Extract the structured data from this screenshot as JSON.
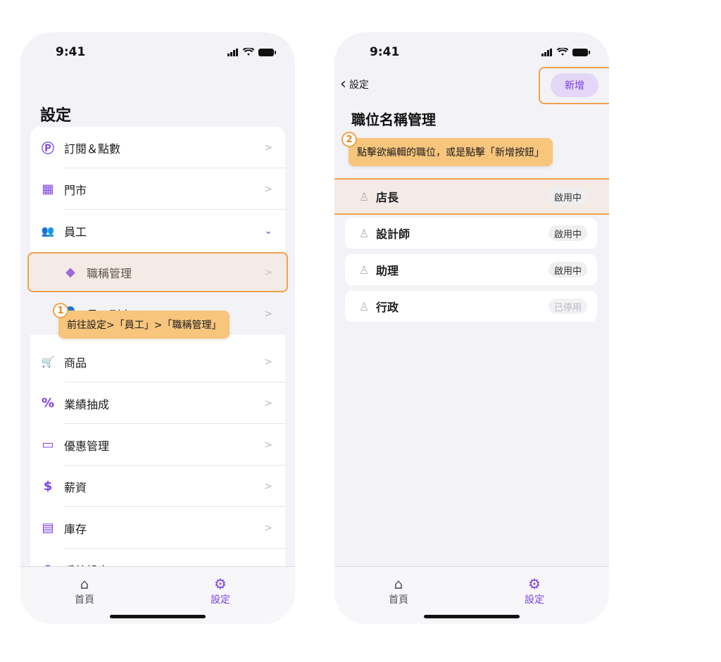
{
  "phone1": {
    "status_time": "9:41",
    "title": "設定",
    "items": [
      {
        "icon": "Ⓟ",
        "label": "訂閱＆點數"
      },
      {
        "icon": "▦",
        "label": "門市"
      },
      {
        "icon": "👥",
        "label": "員工"
      },
      {
        "icon": "◆",
        "label": "職稱管理"
      },
      {
        "icon": "👤",
        "label": "員工列表"
      },
      {
        "icon": "🛒",
        "label": "商品"
      },
      {
        "icon": "%",
        "label": "業績抽成"
      },
      {
        "icon": "▭",
        "label": "優惠管理"
      },
      {
        "icon": "$",
        "label": "薪資"
      },
      {
        "icon": "▤",
        "label": "庫存"
      },
      {
        "icon": "●",
        "label": "系統設定"
      }
    ],
    "tooltip": {
      "step": "1",
      "text": "前往設定>「員工」>「職稱管理」"
    },
    "tabs": [
      {
        "label": "首頁",
        "icon": "⌂"
      },
      {
        "label": "設定",
        "icon": "⚙"
      }
    ]
  },
  "phone2": {
    "status_time": "9:41",
    "back_label": "設定",
    "add_button": "新增",
    "title": "職位名稱管理",
    "tooltip": {
      "step": "2",
      "text": "點擊欲編輯的職位，或是點擊「新增按鈕」"
    },
    "jobs": [
      {
        "name": "店長",
        "status": "啟用中"
      },
      {
        "name": "設計師",
        "status": "啟用中"
      },
      {
        "name": "助理",
        "status": "啟用中"
      },
      {
        "name": "行政",
        "status": "已停用"
      }
    ],
    "tabs": [
      {
        "label": "首頁",
        "icon": "⌂"
      },
      {
        "label": "設定",
        "icon": "⚙"
      }
    ]
  },
  "colors": {
    "accent": "#7b3fe4",
    "highlight": "#f0a24a",
    "tooltip_bg": "#f7c57c"
  }
}
